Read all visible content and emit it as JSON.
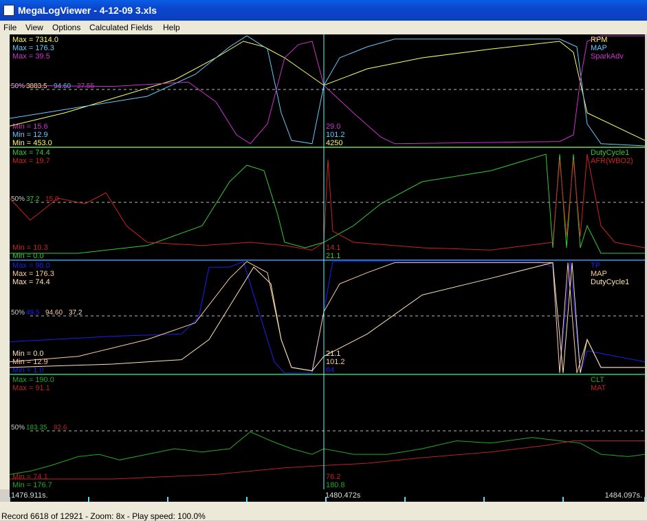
{
  "window": {
    "title": "MegaLogViewer - 4-12-09 3.xls"
  },
  "menu": [
    "File",
    "View",
    "Options",
    "Calculated Fields",
    "Help"
  ],
  "status": "Record 6618 of 12921 - Zoom: 8x - Play speed: 100.0%",
  "time_axis": {
    "start": "1476.911s.",
    "cursor": "1480.472s",
    "end": "1484.097s."
  },
  "colors": {
    "yellow": "#ffff66",
    "cyan": "#66ccff",
    "magenta": "#cc33cc",
    "green": "#33cc33",
    "red": "#cc2222",
    "blue": "#1e1ef0",
    "peach": "#ffcc99",
    "tan": "#ffe4b5",
    "darkgreen": "#22aa22",
    "darkred": "#bb2222",
    "mid": "#cccccc"
  },
  "panels": [
    {
      "legend": [
        {
          "name": "RPM",
          "color": "yellow"
        },
        {
          "name": "MAP",
          "color": "cyan"
        },
        {
          "name": "SparkAdv",
          "color": "magenta"
        }
      ],
      "max": [
        {
          "text": "Max = 7314.0",
          "color": "yellow"
        },
        {
          "text": "Max = 176.3",
          "color": "cyan"
        },
        {
          "text": "Max = 39.5",
          "color": "magenta"
        }
      ],
      "min": [
        {
          "text": "Min = 15.6",
          "color": "magenta"
        },
        {
          "text": "Min = 12.9",
          "color": "cyan"
        },
        {
          "text": "Min = 453.0",
          "color": "yellow"
        }
      ],
      "mid": [
        {
          "text": "50%",
          "color": "mid"
        },
        {
          "text": "3883.5",
          "color": "yellow"
        },
        {
          "text": "94.60",
          "color": "cyan"
        },
        {
          "text": "27.55",
          "color": "magenta"
        }
      ],
      "cursor": [
        {
          "text": "29.0",
          "color": "magenta"
        },
        {
          "text": "101.2",
          "color": "cyan"
        },
        {
          "text": "4250",
          "color": "yellow"
        }
      ]
    },
    {
      "legend": [
        {
          "name": "DutyCycle1",
          "color": "green"
        },
        {
          "name": "AFR(WBO2)",
          "color": "red"
        }
      ],
      "max": [
        {
          "text": "Max = 74.4",
          "color": "green"
        },
        {
          "text": "Max = 19.7",
          "color": "red"
        }
      ],
      "min": [
        {
          "text": "Min = 10.3",
          "color": "red"
        },
        {
          "text": "Min = 0.0",
          "color": "green"
        }
      ],
      "mid": [
        {
          "text": "50%",
          "color": "mid"
        },
        {
          "text": "37.2",
          "color": "green"
        },
        {
          "text": "15.0",
          "color": "red"
        }
      ],
      "cursor": [
        {
          "text": "14.1",
          "color": "red"
        },
        {
          "text": "21.1",
          "color": "green"
        }
      ]
    },
    {
      "legend": [
        {
          "name": "TP",
          "color": "blue"
        },
        {
          "name": "MAP",
          "color": "peach"
        },
        {
          "name": "DutyCycle1",
          "color": "tan"
        }
      ],
      "max": [
        {
          "text": "Max = 98.0",
          "color": "blue"
        },
        {
          "text": "Max = 176.3",
          "color": "peach"
        },
        {
          "text": "Max = 74.4",
          "color": "tan"
        }
      ],
      "min": [
        {
          "text": "Min = 0.0",
          "color": "tan"
        },
        {
          "text": "Min = 12.9",
          "color": "peach"
        },
        {
          "text": "Min = 1.0",
          "color": "blue"
        }
      ],
      "mid": [
        {
          "text": "50%",
          "color": "mid"
        },
        {
          "text": "49.5",
          "color": "blue"
        },
        {
          "text": "94.60",
          "color": "peach"
        },
        {
          "text": "37.2",
          "color": "tan"
        }
      ],
      "cursor": [
        {
          "text": "21.1",
          "color": "tan"
        },
        {
          "text": "101.2",
          "color": "peach"
        },
        {
          "text": "84",
          "color": "blue"
        }
      ]
    },
    {
      "legend": [
        {
          "name": "CLT",
          "color": "darkgreen"
        },
        {
          "name": "MAT",
          "color": "darkred"
        }
      ],
      "max": [
        {
          "text": "Max = 190.0",
          "color": "darkgreen"
        },
        {
          "text": "Max = 91.1",
          "color": "darkred"
        }
      ],
      "min": [
        {
          "text": "Min = 74.1",
          "color": "darkred"
        },
        {
          "text": "Min = 176.7",
          "color": "darkgreen"
        }
      ],
      "mid": [
        {
          "text": "50%",
          "color": "mid"
        },
        {
          "text": "183.35",
          "color": "darkgreen"
        },
        {
          "text": "82.6",
          "color": "darkred"
        }
      ],
      "cursor": [
        {
          "text": "76.2",
          "color": "darkred"
        },
        {
          "text": "180.8",
          "color": "darkgreen"
        }
      ]
    }
  ]
}
